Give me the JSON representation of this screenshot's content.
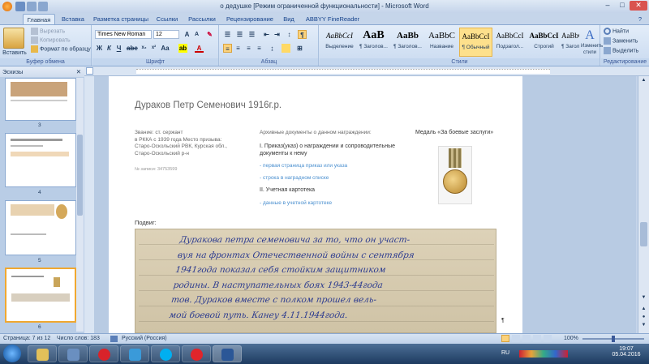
{
  "window": {
    "title": "о дедушке [Режим ограниченной функциональности] - Microsoft Word"
  },
  "tabs": [
    "Главная",
    "Вставка",
    "Разметка страницы",
    "Ссылки",
    "Рассылки",
    "Рецензирование",
    "Вид",
    "ABBYY FineReader 12"
  ],
  "ribbon": {
    "clipboard": {
      "label": "Буфер обмена",
      "paste": "Вставить",
      "cut": "Вырезать",
      "copy": "Копировать",
      "format_painter": "Формат по образцу"
    },
    "font": {
      "label": "Шрифт",
      "font_name": "Times New Roman",
      "font_size": "12"
    },
    "paragraph": {
      "label": "Абзац"
    },
    "styles": {
      "label": "Стили",
      "items": [
        {
          "sample": "AaBbCcI",
          "name": "Выделение"
        },
        {
          "sample": "AaB",
          "name": "¶ Заголов..."
        },
        {
          "sample": "AaBb",
          "name": "¶ Заголов..."
        },
        {
          "sample": "AaBbC",
          "name": "Название"
        },
        {
          "sample": "AaBbCcI",
          "name": "¶ Обычный"
        },
        {
          "sample": "AaBbCcI",
          "name": "Подзагол..."
        },
        {
          "sample": "AaBbCcI",
          "name": "Строгий"
        },
        {
          "sample": "AaBbCcI",
          "name": "¶ Заголов..."
        }
      ],
      "change_styles": "Изменить стили"
    },
    "editing": {
      "label": "Редактирование",
      "find": "Найти",
      "replace": "Заменить",
      "select": "Выделить"
    }
  },
  "thumbnails": {
    "header": "Эскизы",
    "pages": [
      "3",
      "4",
      "5",
      "6"
    ]
  },
  "document": {
    "heading": "Дураков Петр Семенович 1916г.р.",
    "left_col": [
      "Звание: ст. сержант",
      "в РККА с 1939 года Место призыва:",
      "Старо-Оскольский РВК, Курская обл.,",
      "Старо-Оскольский р-н"
    ],
    "record_no": "№ записи: 34753599",
    "archive_title": "Архивные документы о данном награждении:",
    "archive_1": "I. Приказ(указ) о награждении и сопроводительные документы к нему",
    "link_1": "- первая страница приказ или указа",
    "link_2": "- строка в наградном списке",
    "archive_2": "II. Учетная картотека",
    "link_3": "- данные в учетной картотеке",
    "medal_title": "Медаль «За боевые заслуги»",
    "feat_label": "Подвиг:",
    "handwriting": [
      "Дуракова петра семеновича за то, что он участ-",
      "вуя на фронтах Отечественной войны с сентября",
      "1941года показал себя стойким защитником",
      "родины. В наступательных боях 1943-44года",
      "тов. Дураков вместе с полком прошел вель-",
      "мой боевой путь.  Канеу 4.11.1944года."
    ]
  },
  "status": {
    "page": "Страница: 7 из 12",
    "words": "Число слов: 183",
    "lang": "Русский (Россия)",
    "zoom": "100%"
  },
  "taskbar": {
    "lang": "RU",
    "time": "19:07",
    "date": "05.04.2016"
  }
}
